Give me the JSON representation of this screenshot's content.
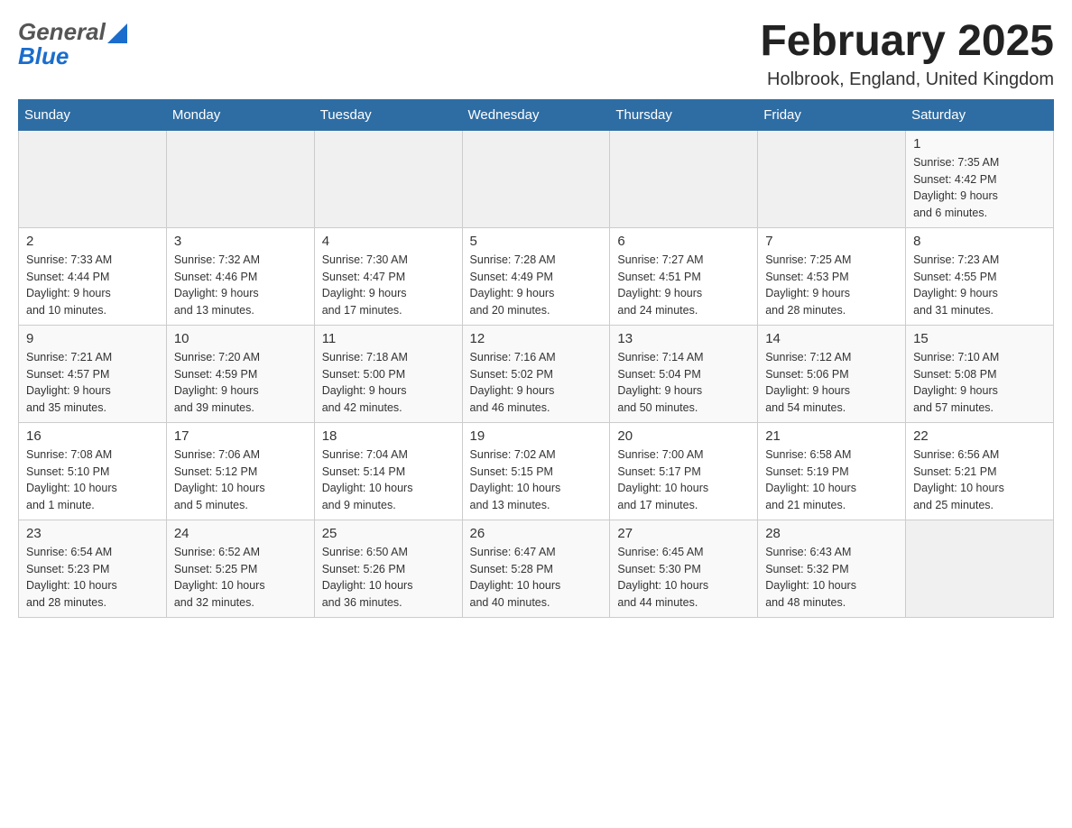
{
  "header": {
    "logo_general": "General",
    "logo_blue": "Blue",
    "month_title": "February 2025",
    "location": "Holbrook, England, United Kingdom"
  },
  "calendar": {
    "days_of_week": [
      "Sunday",
      "Monday",
      "Tuesday",
      "Wednesday",
      "Thursday",
      "Friday",
      "Saturday"
    ],
    "weeks": [
      [
        {
          "day": "",
          "info": ""
        },
        {
          "day": "",
          "info": ""
        },
        {
          "day": "",
          "info": ""
        },
        {
          "day": "",
          "info": ""
        },
        {
          "day": "",
          "info": ""
        },
        {
          "day": "",
          "info": ""
        },
        {
          "day": "1",
          "info": "Sunrise: 7:35 AM\nSunset: 4:42 PM\nDaylight: 9 hours\nand 6 minutes."
        }
      ],
      [
        {
          "day": "2",
          "info": "Sunrise: 7:33 AM\nSunset: 4:44 PM\nDaylight: 9 hours\nand 10 minutes."
        },
        {
          "day": "3",
          "info": "Sunrise: 7:32 AM\nSunset: 4:46 PM\nDaylight: 9 hours\nand 13 minutes."
        },
        {
          "day": "4",
          "info": "Sunrise: 7:30 AM\nSunset: 4:47 PM\nDaylight: 9 hours\nand 17 minutes."
        },
        {
          "day": "5",
          "info": "Sunrise: 7:28 AM\nSunset: 4:49 PM\nDaylight: 9 hours\nand 20 minutes."
        },
        {
          "day": "6",
          "info": "Sunrise: 7:27 AM\nSunset: 4:51 PM\nDaylight: 9 hours\nand 24 minutes."
        },
        {
          "day": "7",
          "info": "Sunrise: 7:25 AM\nSunset: 4:53 PM\nDaylight: 9 hours\nand 28 minutes."
        },
        {
          "day": "8",
          "info": "Sunrise: 7:23 AM\nSunset: 4:55 PM\nDaylight: 9 hours\nand 31 minutes."
        }
      ],
      [
        {
          "day": "9",
          "info": "Sunrise: 7:21 AM\nSunset: 4:57 PM\nDaylight: 9 hours\nand 35 minutes."
        },
        {
          "day": "10",
          "info": "Sunrise: 7:20 AM\nSunset: 4:59 PM\nDaylight: 9 hours\nand 39 minutes."
        },
        {
          "day": "11",
          "info": "Sunrise: 7:18 AM\nSunset: 5:00 PM\nDaylight: 9 hours\nand 42 minutes."
        },
        {
          "day": "12",
          "info": "Sunrise: 7:16 AM\nSunset: 5:02 PM\nDaylight: 9 hours\nand 46 minutes."
        },
        {
          "day": "13",
          "info": "Sunrise: 7:14 AM\nSunset: 5:04 PM\nDaylight: 9 hours\nand 50 minutes."
        },
        {
          "day": "14",
          "info": "Sunrise: 7:12 AM\nSunset: 5:06 PM\nDaylight: 9 hours\nand 54 minutes."
        },
        {
          "day": "15",
          "info": "Sunrise: 7:10 AM\nSunset: 5:08 PM\nDaylight: 9 hours\nand 57 minutes."
        }
      ],
      [
        {
          "day": "16",
          "info": "Sunrise: 7:08 AM\nSunset: 5:10 PM\nDaylight: 10 hours\nand 1 minute."
        },
        {
          "day": "17",
          "info": "Sunrise: 7:06 AM\nSunset: 5:12 PM\nDaylight: 10 hours\nand 5 minutes."
        },
        {
          "day": "18",
          "info": "Sunrise: 7:04 AM\nSunset: 5:14 PM\nDaylight: 10 hours\nand 9 minutes."
        },
        {
          "day": "19",
          "info": "Sunrise: 7:02 AM\nSunset: 5:15 PM\nDaylight: 10 hours\nand 13 minutes."
        },
        {
          "day": "20",
          "info": "Sunrise: 7:00 AM\nSunset: 5:17 PM\nDaylight: 10 hours\nand 17 minutes."
        },
        {
          "day": "21",
          "info": "Sunrise: 6:58 AM\nSunset: 5:19 PM\nDaylight: 10 hours\nand 21 minutes."
        },
        {
          "day": "22",
          "info": "Sunrise: 6:56 AM\nSunset: 5:21 PM\nDaylight: 10 hours\nand 25 minutes."
        }
      ],
      [
        {
          "day": "23",
          "info": "Sunrise: 6:54 AM\nSunset: 5:23 PM\nDaylight: 10 hours\nand 28 minutes."
        },
        {
          "day": "24",
          "info": "Sunrise: 6:52 AM\nSunset: 5:25 PM\nDaylight: 10 hours\nand 32 minutes."
        },
        {
          "day": "25",
          "info": "Sunrise: 6:50 AM\nSunset: 5:26 PM\nDaylight: 10 hours\nand 36 minutes."
        },
        {
          "day": "26",
          "info": "Sunrise: 6:47 AM\nSunset: 5:28 PM\nDaylight: 10 hours\nand 40 minutes."
        },
        {
          "day": "27",
          "info": "Sunrise: 6:45 AM\nSunset: 5:30 PM\nDaylight: 10 hours\nand 44 minutes."
        },
        {
          "day": "28",
          "info": "Sunrise: 6:43 AM\nSunset: 5:32 PM\nDaylight: 10 hours\nand 48 minutes."
        },
        {
          "day": "",
          "info": ""
        }
      ]
    ]
  }
}
